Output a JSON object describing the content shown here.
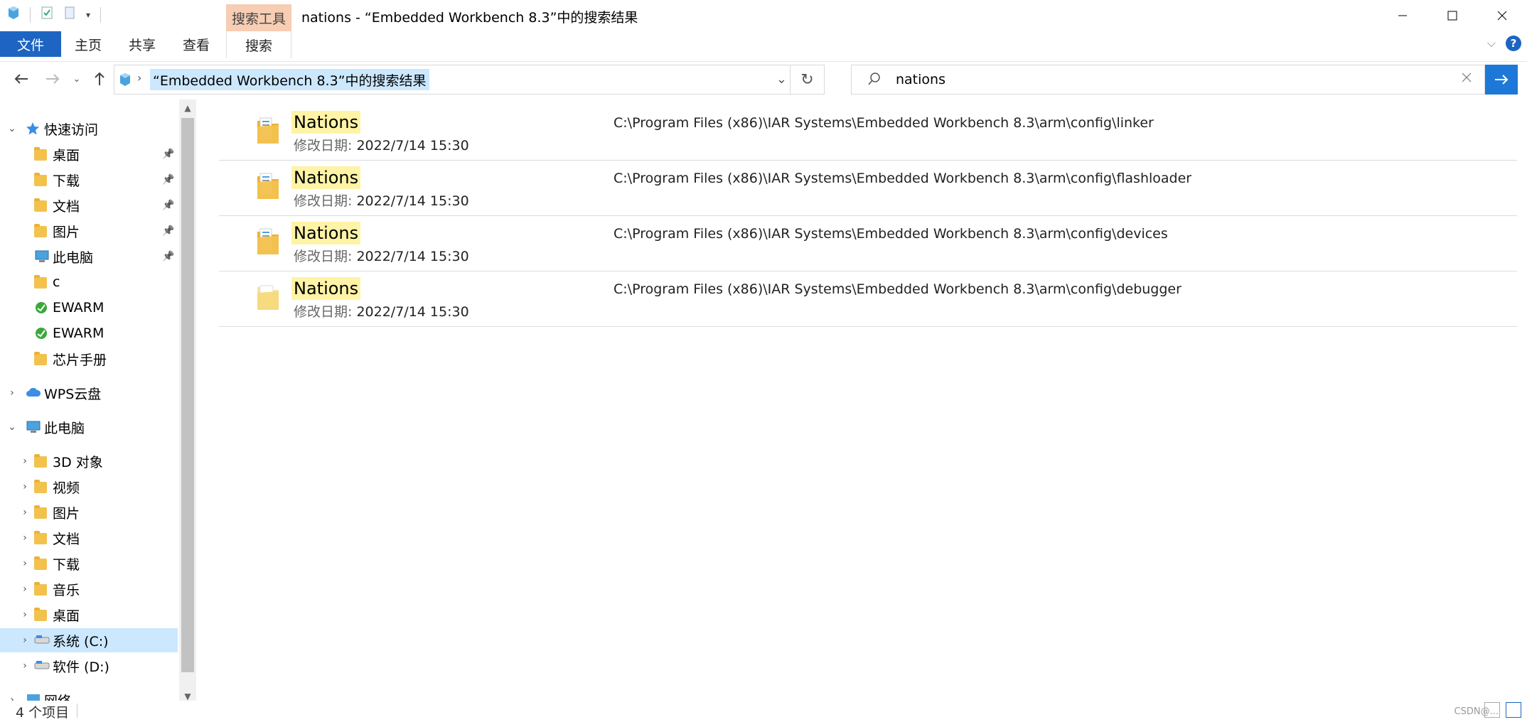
{
  "window": {
    "title": "nations - “Embedded Workbench 8.3”中的搜索结果",
    "contextual_tab_group": "搜索工具",
    "controls": [
      "minimize-icon",
      "maximize-icon",
      "close-icon"
    ]
  },
  "ribbon": {
    "tabs": [
      {
        "label": "文件"
      },
      {
        "label": "主页"
      },
      {
        "label": "共享"
      },
      {
        "label": "查看"
      },
      {
        "label": "搜索"
      }
    ],
    "help_label": "?"
  },
  "navigation": {
    "address": "“Embedded Workbench 8.3”中的搜索结果",
    "search_value": "nations",
    "search_icon": "search-icon",
    "go_icon": "arrow-right-icon"
  },
  "tree": {
    "items": [
      {
        "label": "快速访问",
        "icon": "star-icon",
        "level": 0,
        "expanded": true
      },
      {
        "label": "桌面",
        "icon": "desktop-folder-icon",
        "level": 1,
        "pinned": true
      },
      {
        "label": "下载",
        "icon": "download-folder-icon",
        "level": 1,
        "pinned": true
      },
      {
        "label": "文档",
        "icon": "documents-folder-icon",
        "level": 1,
        "pinned": true
      },
      {
        "label": "图片",
        "icon": "pictures-folder-icon",
        "level": 1,
        "pinned": true
      },
      {
        "label": "此电脑",
        "icon": "computer-icon",
        "level": 1,
        "pinned": true
      },
      {
        "label": "c",
        "icon": "folder-icon",
        "level": 1
      },
      {
        "label": "EWARM",
        "icon": "ewarm-icon",
        "level": 1
      },
      {
        "label": "EWARM",
        "icon": "ewarm-icon",
        "level": 1
      },
      {
        "label": "芯片手册",
        "icon": "folder-icon",
        "level": 1
      },
      {
        "label": "WPS云盘",
        "icon": "cloud-icon",
        "level": 0,
        "expanded": false
      },
      {
        "label": "此电脑",
        "icon": "computer-icon",
        "level": 0,
        "expanded": true
      },
      {
        "label": "3D 对象",
        "icon": "3d-folder-icon",
        "level": 1,
        "expandable": true
      },
      {
        "label": "视频",
        "icon": "video-folder-icon",
        "level": 1,
        "expandable": true
      },
      {
        "label": "图片",
        "icon": "pictures-folder-icon",
        "level": 1,
        "expandable": true
      },
      {
        "label": "文档",
        "icon": "documents-folder-icon",
        "level": 1,
        "expandable": true
      },
      {
        "label": "下载",
        "icon": "download-folder-icon",
        "level": 1,
        "expandable": true
      },
      {
        "label": "音乐",
        "icon": "music-folder-icon",
        "level": 1,
        "expandable": true
      },
      {
        "label": "桌面",
        "icon": "desktop-folder-icon",
        "level": 1,
        "expandable": true
      },
      {
        "label": "系统 (C:)",
        "icon": "drive-icon",
        "level": 1,
        "expandable": true,
        "selected": true
      },
      {
        "label": "软件 (D:)",
        "icon": "drive-icon",
        "level": 1,
        "expandable": true
      },
      {
        "label": "网络",
        "icon": "network-icon",
        "level": 0,
        "expanded": false
      }
    ]
  },
  "results": {
    "date_label": "修改日期:",
    "items": [
      {
        "name": "Nations",
        "date": "2022/7/14 15:30",
        "path": "C:\\Program Files (x86)\\IAR Systems\\Embedded Workbench 8.3\\arm\\config\\linker",
        "icon": "folder-icon"
      },
      {
        "name": "Nations",
        "date": "2022/7/14 15:30",
        "path": "C:\\Program Files (x86)\\IAR Systems\\Embedded Workbench 8.3\\arm\\config\\flashloader",
        "icon": "folder-icon"
      },
      {
        "name": "Nations",
        "date": "2022/7/14 15:30",
        "path": "C:\\Program Files (x86)\\IAR Systems\\Embedded Workbench 8.3\\arm\\config\\devices",
        "icon": "folder-icon"
      },
      {
        "name": "Nations",
        "date": "2022/7/14 15:30",
        "path": "C:\\Program Files (x86)\\IAR Systems\\Embedded Workbench 8.3\\arm\\config\\debugger",
        "icon": "empty-folder-icon"
      }
    ]
  },
  "status": {
    "count": "4 个项目",
    "watermark": "CSDN@..."
  },
  "colors": {
    "accent": "#1e65c2",
    "highlight": "#fff3a6",
    "selection": "#cce8ff",
    "contextual_tab": "#f7cdb4"
  }
}
